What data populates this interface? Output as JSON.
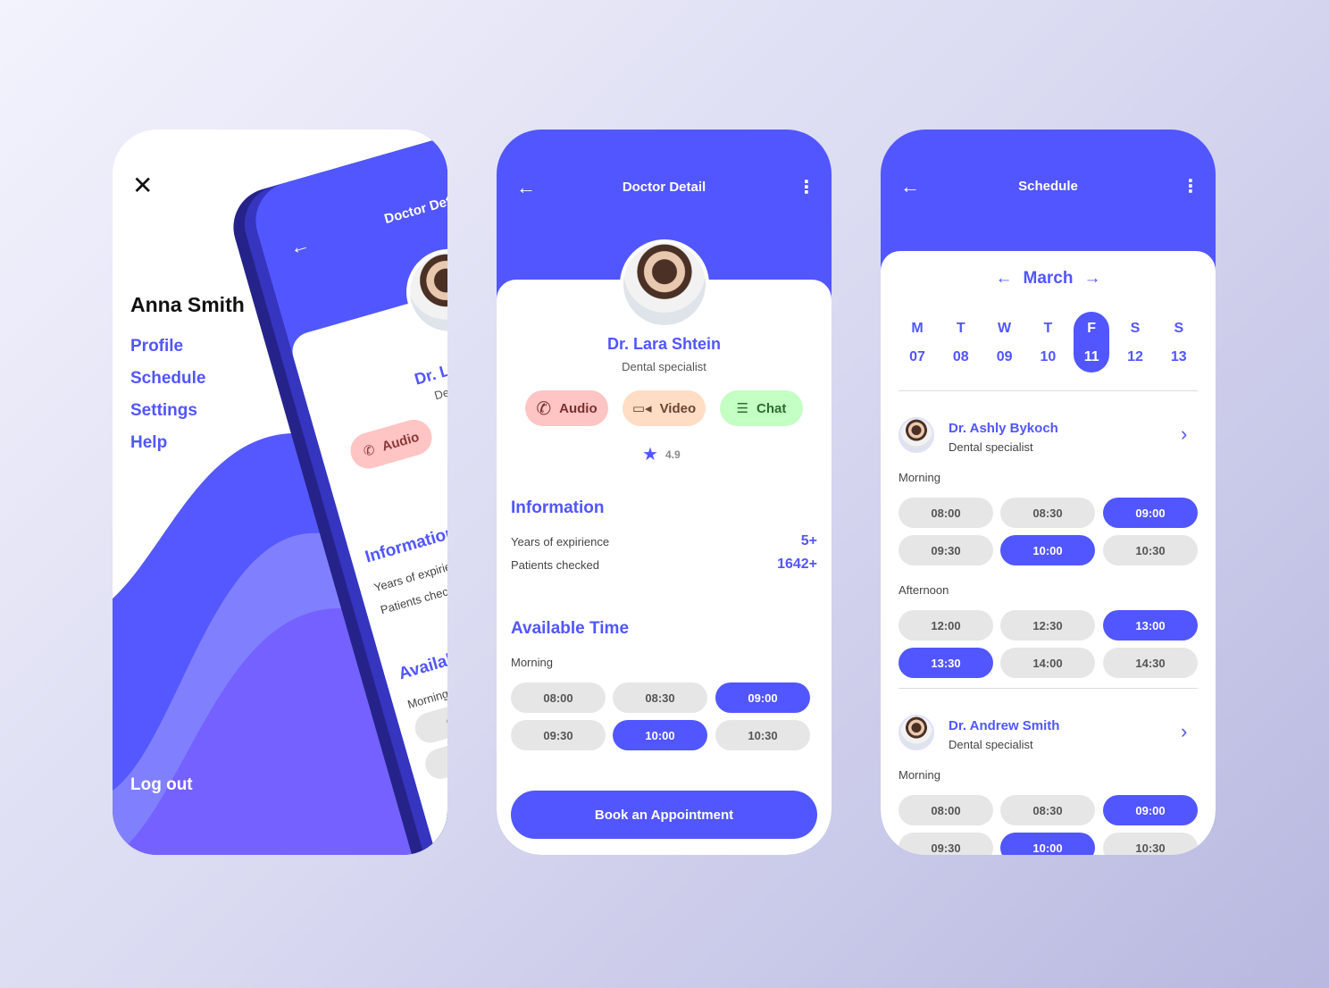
{
  "colors": {
    "primary": "#5156FF",
    "audio_bg": "#FFC4C4",
    "video_bg": "#FFDDC4",
    "chat_bg": "#C4FFC4"
  },
  "menu": {
    "user_name": "Anna Smith",
    "items": [
      {
        "label": "Profile"
      },
      {
        "label": "Schedule"
      },
      {
        "label": "Settings"
      },
      {
        "label": "Help"
      }
    ],
    "logout": "Log out"
  },
  "detail": {
    "title": "Doctor Detail",
    "doctor_name": "Dr. Lara Shtein",
    "specialty": "Dental specialist",
    "contact": {
      "audio": "Audio",
      "video": "Video",
      "chat": "Chat"
    },
    "rating": "4.9",
    "info_title": "Information",
    "info": [
      {
        "label": "Years of expirience",
        "value": "5+"
      },
      {
        "label": "Patients checked",
        "value": "1642+"
      }
    ],
    "available_title": "Available Time",
    "morning_label": "Morning",
    "slots": [
      {
        "time": "08:00",
        "selected": false
      },
      {
        "time": "08:30",
        "selected": false
      },
      {
        "time": "09:00",
        "selected": true
      },
      {
        "time": "09:30",
        "selected": false
      },
      {
        "time": "10:00",
        "selected": true
      },
      {
        "time": "10:30",
        "selected": false
      }
    ],
    "book_label": "Book an Appointment"
  },
  "schedule": {
    "title": "Schedule",
    "month": "March",
    "days": [
      {
        "letter": "M",
        "num": "07"
      },
      {
        "letter": "T",
        "num": "08"
      },
      {
        "letter": "W",
        "num": "09"
      },
      {
        "letter": "T",
        "num": "10"
      },
      {
        "letter": "F",
        "num": "11",
        "selected": true
      },
      {
        "letter": "S",
        "num": "12"
      },
      {
        "letter": "S",
        "num": "13"
      }
    ],
    "doctors": [
      {
        "name": "Dr. Ashly Bykoch",
        "specialty": "Dental specialist",
        "morning_label": "Morning",
        "afternoon_label": "Afternoon",
        "morning": [
          {
            "time": "08:00"
          },
          {
            "time": "08:30"
          },
          {
            "time": "09:00",
            "selected": true
          },
          {
            "time": "09:30"
          },
          {
            "time": "10:00",
            "selected": true
          },
          {
            "time": "10:30"
          }
        ],
        "afternoon": [
          {
            "time": "12:00"
          },
          {
            "time": "12:30"
          },
          {
            "time": "13:00",
            "selected": true
          },
          {
            "time": "13:30",
            "selected": true
          },
          {
            "time": "14:00"
          },
          {
            "time": "14:30"
          }
        ]
      },
      {
        "name": "Dr. Andrew Smith",
        "specialty": "Dental specialist",
        "morning_label": "Morning",
        "morning": [
          {
            "time": "08:00"
          },
          {
            "time": "08:30"
          },
          {
            "time": "09:00",
            "selected": true
          },
          {
            "time": "09:30"
          },
          {
            "time": "10:00",
            "selected": true
          },
          {
            "time": "10:30"
          }
        ]
      }
    ]
  }
}
